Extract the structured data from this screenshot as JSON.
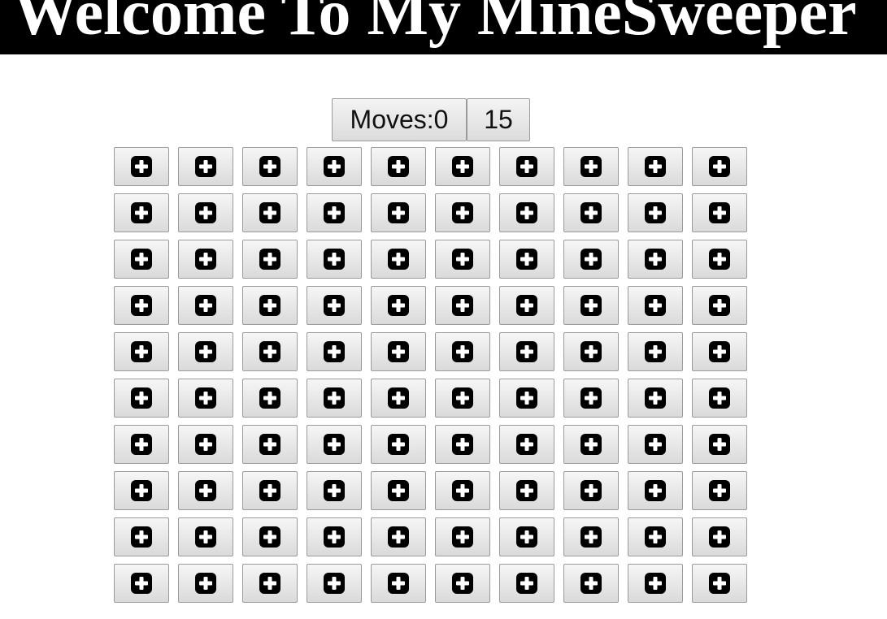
{
  "header": {
    "title": "Welcome To My MineSweeper"
  },
  "status": {
    "moves_label": "Moves:0",
    "mines_count": "15"
  },
  "board": {
    "rows": 10,
    "cols": 10,
    "cell_icon": "plus-square-icon",
    "cell_state": "covered"
  },
  "colors": {
    "header_bg": "#000000",
    "header_text": "#ffffff",
    "icon_fill": "#000000"
  }
}
